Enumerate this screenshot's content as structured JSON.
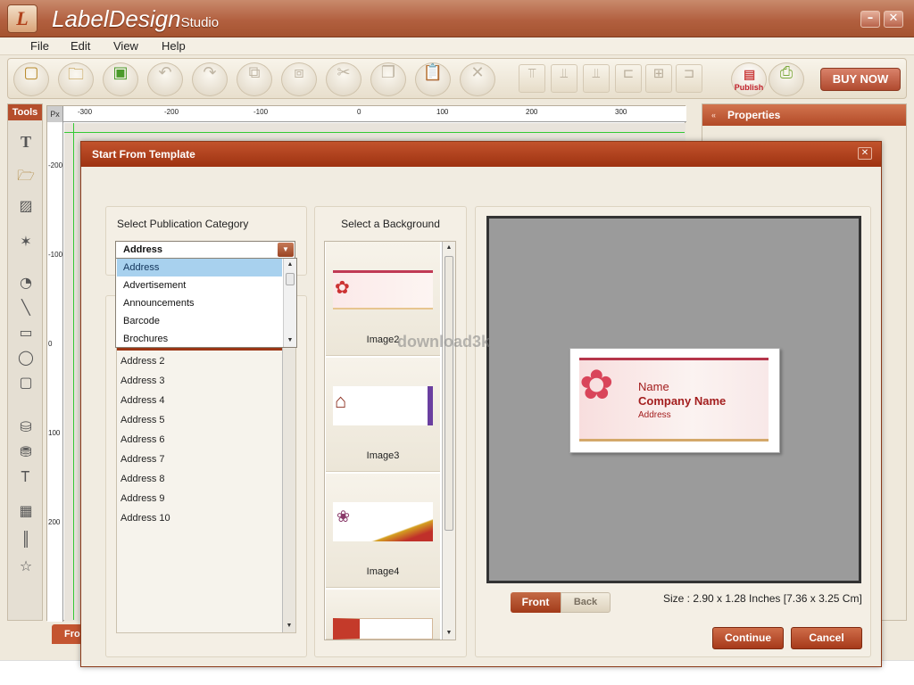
{
  "app": {
    "name": "LabelDesign",
    "name_suffix": "Studio",
    "logo_letter": "L"
  },
  "window_controls": {
    "minimize": "–",
    "close": "✕"
  },
  "menu": [
    "File",
    "Edit",
    "View",
    "Help"
  ],
  "toolbar": {
    "publish_label": "Publish",
    "buy_now": "BUY NOW"
  },
  "tools_panel": {
    "title": "Tools"
  },
  "ruler": {
    "unit": "Px",
    "top_ticks": [
      "-300",
      "-200",
      "-100",
      "0",
      "100",
      "200",
      "300"
    ],
    "left_ticks": [
      "-200",
      "-100",
      "0",
      "100",
      "200"
    ]
  },
  "properties": {
    "title": "Properties"
  },
  "bottom_tab": {
    "label": "Fro"
  },
  "dialog": {
    "title": "Start From Template",
    "category_label": "Select Publication Category",
    "selected_category": "Address",
    "category_options": [
      "Address",
      "Advertisement",
      "Announcements",
      "Barcode",
      "Brochures"
    ],
    "templates": [
      "Address 2",
      "Address 3",
      "Address 4",
      "Address 5",
      "Address 6",
      "Address 7",
      "Address 8",
      "Address 9",
      "Address 10"
    ],
    "background_label": "Select a Background",
    "backgrounds": [
      "Image2",
      "Image3",
      "Image4"
    ],
    "label_preview": {
      "name": "Name",
      "company": "Company Name",
      "address": "Address"
    },
    "front_tab": "Front",
    "back_tab": "Back",
    "size_text": "Size : 2.90 x 1.28 Inches [7.36 x 3.25 Cm]",
    "continue": "Continue",
    "cancel": "Cancel"
  },
  "watermark": "download3k",
  "colors": {
    "accent": "#b54e2c",
    "dropdown_highlight": "#a8d1ee",
    "label_text": "#a31e1e"
  }
}
